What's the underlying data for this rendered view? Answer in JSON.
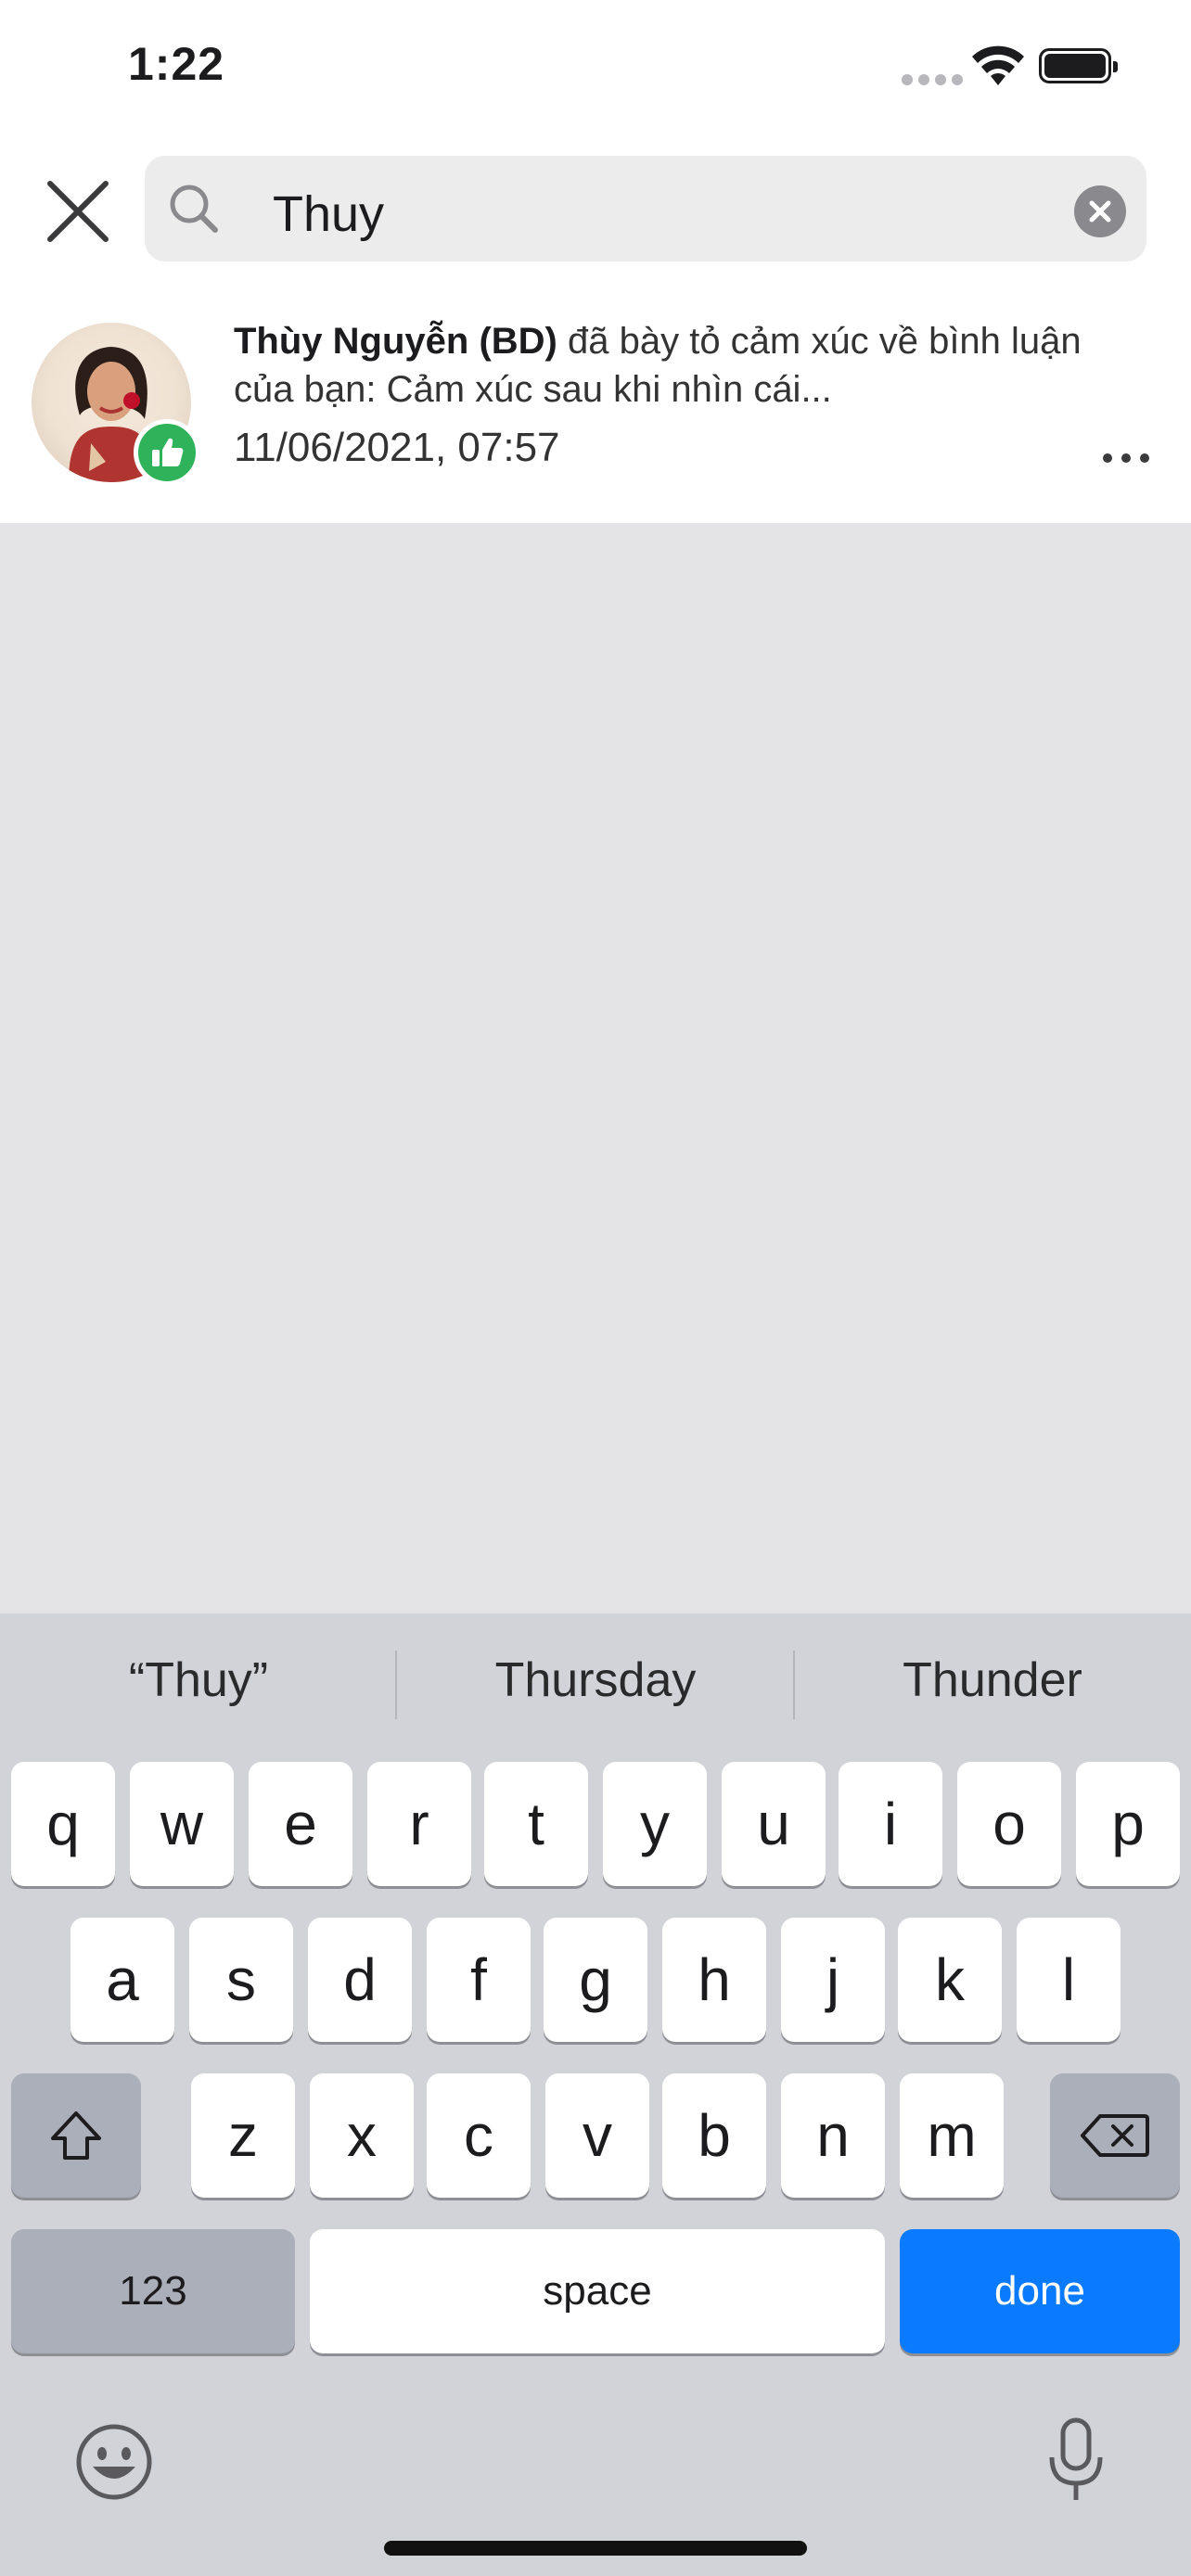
{
  "status_bar": {
    "time": "1:22",
    "icons": [
      "cellular-icon",
      "wifi-icon",
      "battery-icon"
    ]
  },
  "search": {
    "query": "Thuy",
    "close_icon": "close-icon",
    "search_icon": "search-icon",
    "clear_icon": "clear-icon"
  },
  "results": [
    {
      "name": "Thùy Nguyễn (BD)",
      "text": " đã bày tỏ cảm xúc về bình luận của bạn: Cảm xúc sau khi nhìn cái...",
      "datetime": "11/06/2021, 07:57",
      "reaction_icon": "like-icon",
      "reaction_color": "#2fb35a",
      "more_icon": "more-icon"
    }
  ],
  "keyboard": {
    "suggestions": [
      "“Thuy”",
      "Thursday",
      "Thunder"
    ],
    "row1": [
      "q",
      "w",
      "e",
      "r",
      "t",
      "y",
      "u",
      "i",
      "o",
      "p"
    ],
    "row2": [
      "a",
      "s",
      "d",
      "f",
      "g",
      "h",
      "j",
      "k",
      "l"
    ],
    "row3": [
      "z",
      "x",
      "c",
      "v",
      "b",
      "n",
      "m"
    ],
    "numbers_label": "123",
    "space_label": "space",
    "done_label": "done",
    "done_color": "#0a7aff"
  }
}
